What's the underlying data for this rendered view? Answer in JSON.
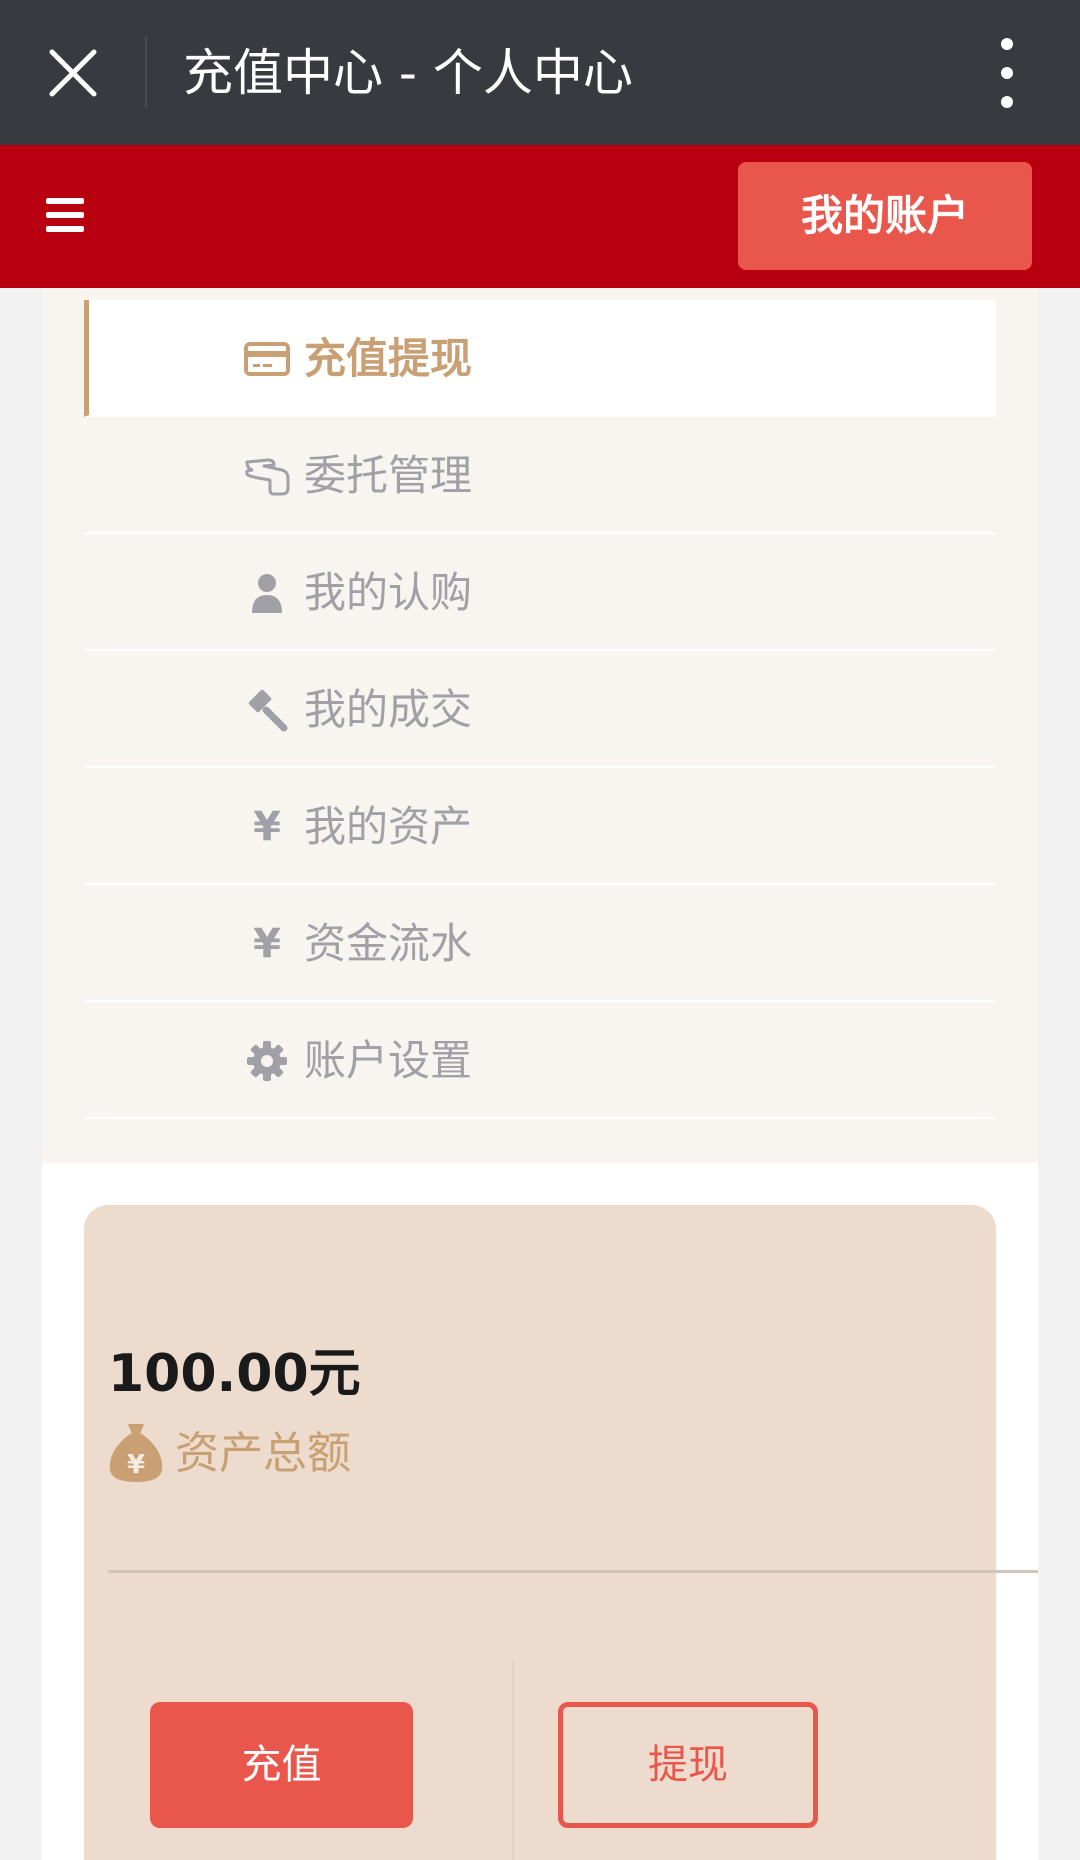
{
  "topbar": {
    "title": "充值中心 - 个人中心",
    "close_icon": "close-icon",
    "more_icon": "more-vertical-icon"
  },
  "header": {
    "menu_icon": "hamburger-menu-icon",
    "account_label": "我的账户"
  },
  "menu": {
    "items": [
      {
        "label": "充值提现",
        "icon": "credit-card-icon",
        "active": true
      },
      {
        "label": "委托管理",
        "icon": "hand-icon",
        "active": false
      },
      {
        "label": "我的认购",
        "icon": "user-icon",
        "active": false
      },
      {
        "label": "我的成交",
        "icon": "gavel-icon",
        "active": false
      },
      {
        "label": "我的资产",
        "icon": "yen-icon",
        "active": false,
        "glyph": "¥"
      },
      {
        "label": "资金流水",
        "icon": "yen-icon",
        "active": false,
        "glyph": "¥"
      },
      {
        "label": "账户设置",
        "icon": "gear-icon",
        "active": false
      }
    ]
  },
  "asset": {
    "amount": "100.00元",
    "label": "资产总额",
    "icon": "money-bag-icon"
  },
  "actions": {
    "recharge_label": "充值",
    "withdraw_label": "提现"
  },
  "colors": {
    "topbar": "#393a3f",
    "header_red": "#b90010",
    "accent_red": "#e9564c",
    "gold": "#c8a074",
    "card_bg": "#eddccd",
    "menu_bg": "#f8f4f0",
    "muted_text": "#a0a0a6"
  }
}
